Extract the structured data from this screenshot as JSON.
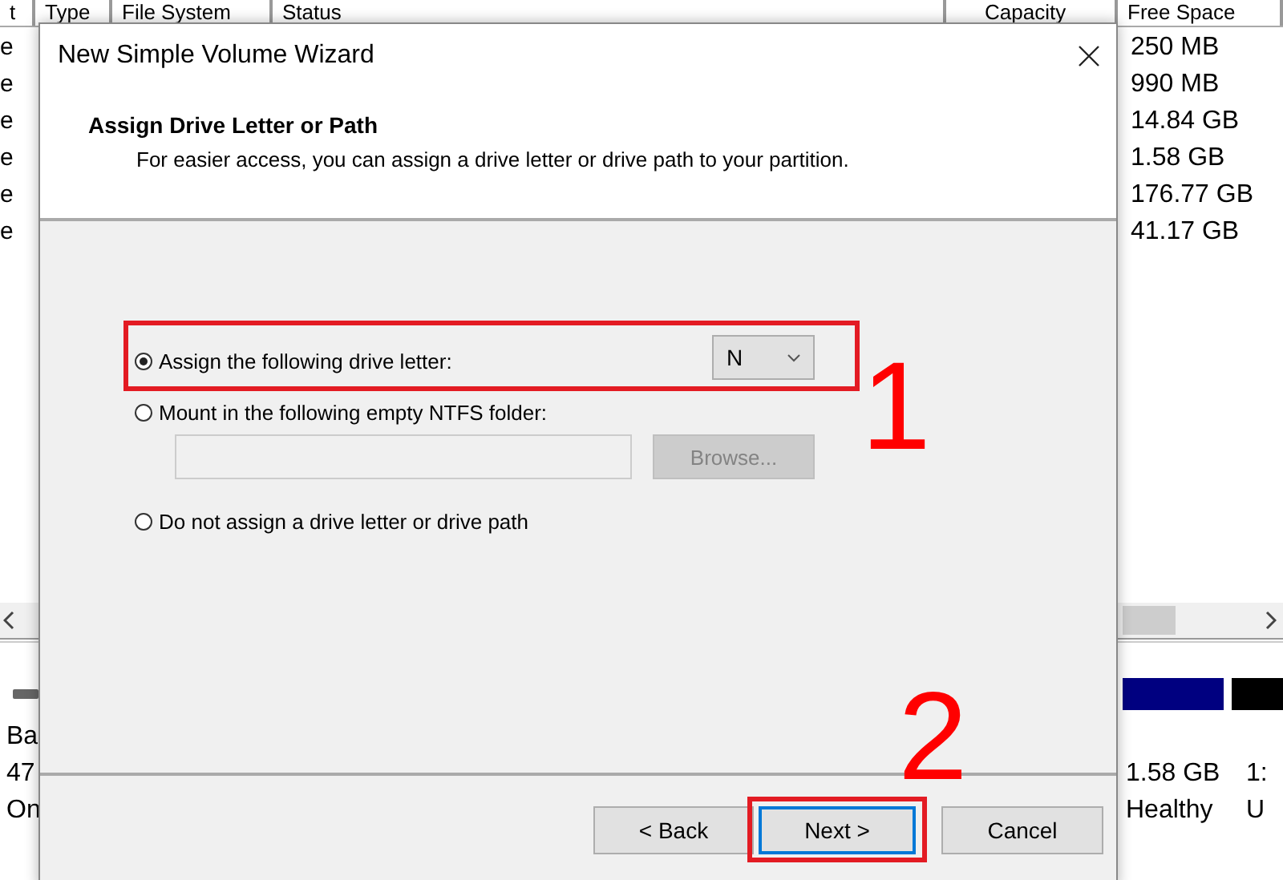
{
  "background_window": {
    "columns": [
      "t",
      "Type",
      "File System",
      "Status",
      "Capacity",
      "Free Space"
    ],
    "left_cells": [
      "e",
      "e",
      "e",
      "e",
      "e",
      "e"
    ],
    "free_space": [
      "250 MB",
      "990 MB",
      "14.84 GB",
      "1.58 GB",
      "176.77 GB",
      "41.17 GB"
    ],
    "disk_info": [
      "Ba",
      "47",
      "On"
    ],
    "partition": [
      "1.58 GB",
      "Healthy"
    ],
    "partition_2": [
      "1:",
      "U"
    ]
  },
  "dialog": {
    "title": "New Simple Volume Wizard",
    "heading": "Assign Drive Letter or Path",
    "description": "For easier access, you can assign a drive letter or drive path to your partition.",
    "options": [
      {
        "kind": "drive_letter",
        "label": "Assign the following drive letter:",
        "selected": true,
        "value": "N"
      },
      {
        "kind": "folder",
        "label": "Mount in the following empty NTFS folder:",
        "selected": false,
        "button": "Browse...",
        "disabled": true
      },
      {
        "kind": "none",
        "label": "Do not assign a drive letter or drive path",
        "selected": false
      }
    ],
    "buttons": [
      {
        "label": "< Back",
        "focused": false
      },
      {
        "label": "Next >",
        "focused": true
      },
      {
        "label": "Cancel",
        "focused": false
      }
    ]
  },
  "annotations": [
    {
      "label": "1"
    },
    {
      "label": "2"
    }
  ]
}
